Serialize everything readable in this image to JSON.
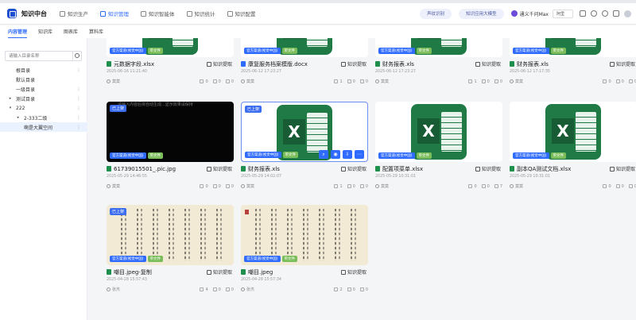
{
  "header": {
    "app_title": "知识中台",
    "nav": [
      {
        "label": "知识生产",
        "icon": "box-icon"
      },
      {
        "label": "知识管理",
        "icon": "list-icon",
        "active": true
      },
      {
        "label": "知识智能体",
        "icon": "gear-icon"
      },
      {
        "label": "知识统计",
        "icon": "chart-icon"
      },
      {
        "label": "知识配置",
        "icon": "settings-icon"
      }
    ],
    "pill1": "声纹识别",
    "pill2": "知识应用大模型",
    "model_name": "通义千问Max",
    "model_tag": "阿里"
  },
  "subtabs": [
    {
      "label": "内容管理",
      "active": true
    },
    {
      "label": "知识库"
    },
    {
      "label": "图表库"
    },
    {
      "label": "算料库"
    }
  ],
  "sidebar": {
    "search_placeholder": "请输入目录名称",
    "tree": [
      {
        "label": "根目录",
        "indent": 0,
        "caret": "",
        "dots": true
      },
      {
        "label": "默认目录",
        "indent": 0,
        "caret": "",
        "dots": false
      },
      {
        "label": "一级目录",
        "indent": 0,
        "caret": "",
        "dots": true
      },
      {
        "label": "测试目录",
        "indent": 0,
        "caret": "▸",
        "dots": true
      },
      {
        "label": "222",
        "indent": 0,
        "caret": "▾",
        "dots": true
      },
      {
        "label": "2-333二级",
        "indent": 1,
        "caret": "▸",
        "dots": true
      },
      {
        "label": "啊是大翼空间",
        "indent": 1,
        "caret": "",
        "dots": true,
        "selected": true
      }
    ]
  },
  "labels": {
    "source": "官方渠道(视觉中国)",
    "type": "单文件",
    "uploaded": "已上架",
    "extract": "知识提取"
  },
  "cards": [
    {
      "name": "元数据字段.xlsx",
      "file": "xls",
      "thumb": "excel",
      "date": "2025-06-16 11:21:40",
      "user": "莫莫",
      "s1": "0",
      "s2": "0",
      "s3": "0"
    },
    {
      "name": "康复服务档案模版.docx",
      "file": "doc",
      "thumb": "excel",
      "date": "2025-06-12 17:23:27",
      "user": "莫莫",
      "s1": "1",
      "s2": "0",
      "s3": "0"
    },
    {
      "name": "财务报表.xls",
      "file": "xls",
      "thumb": "excel",
      "date": "2025-06-12 17:23:27",
      "user": "莫莫",
      "s1": "1",
      "s2": "0",
      "s3": "0"
    },
    {
      "name": "财务报表.xls",
      "file": "xls",
      "thumb": "excel",
      "date": "2025-06-12 17:17:35",
      "user": "莫莫",
      "s1": "0",
      "s2": "0",
      "s3": "0"
    },
    {
      "name": "61739015501_.pic.jpg",
      "file": "img",
      "thumb": "black",
      "date": "2025-05-29 14:46:55",
      "user": "莫莫",
      "s1": "0",
      "s2": "0",
      "s3": "0",
      "black_text": "请输入内容后将自动生成...显示效果请保持",
      "uploaded": true
    },
    {
      "name": "财务报表.xls",
      "file": "xls",
      "thumb": "excel",
      "date": "2025-05-29 14:02:07",
      "user": "莫莫",
      "s1": "1",
      "s2": "0",
      "s3": "0",
      "uploaded": true,
      "selected": true
    },
    {
      "name": "配置项菜单.xlsx",
      "file": "xls",
      "thumb": "excel",
      "date": "2025-05-29 10:31:01",
      "user": "莫莫",
      "s1": "0",
      "s2": "0",
      "s3": "7"
    },
    {
      "name": "副本QA测试文档.xlsx",
      "file": "xls",
      "thumb": "excel",
      "date": "2025-05-29 10:31:01",
      "user": "莫莫",
      "s1": "0",
      "s2": "0",
      "s3": "0"
    },
    {
      "name": "嘲目.jpeg-复制",
      "file": "img",
      "thumb": "cal",
      "date": "2025-04-28 15:57:43",
      "user": "张杰",
      "s1": "4",
      "s2": "0",
      "s3": "0",
      "uploaded": true
    },
    {
      "name": "嘲目.jpeg",
      "file": "img",
      "thumb": "cal",
      "date": "2025-04-28 15:57:34",
      "user": "张杰",
      "s1": "2",
      "s2": "0",
      "s3": "0"
    }
  ],
  "colors": {
    "accent": "#2f6bff",
    "excel": "#1f7a46",
    "tag_green": "#7bbd5a"
  }
}
